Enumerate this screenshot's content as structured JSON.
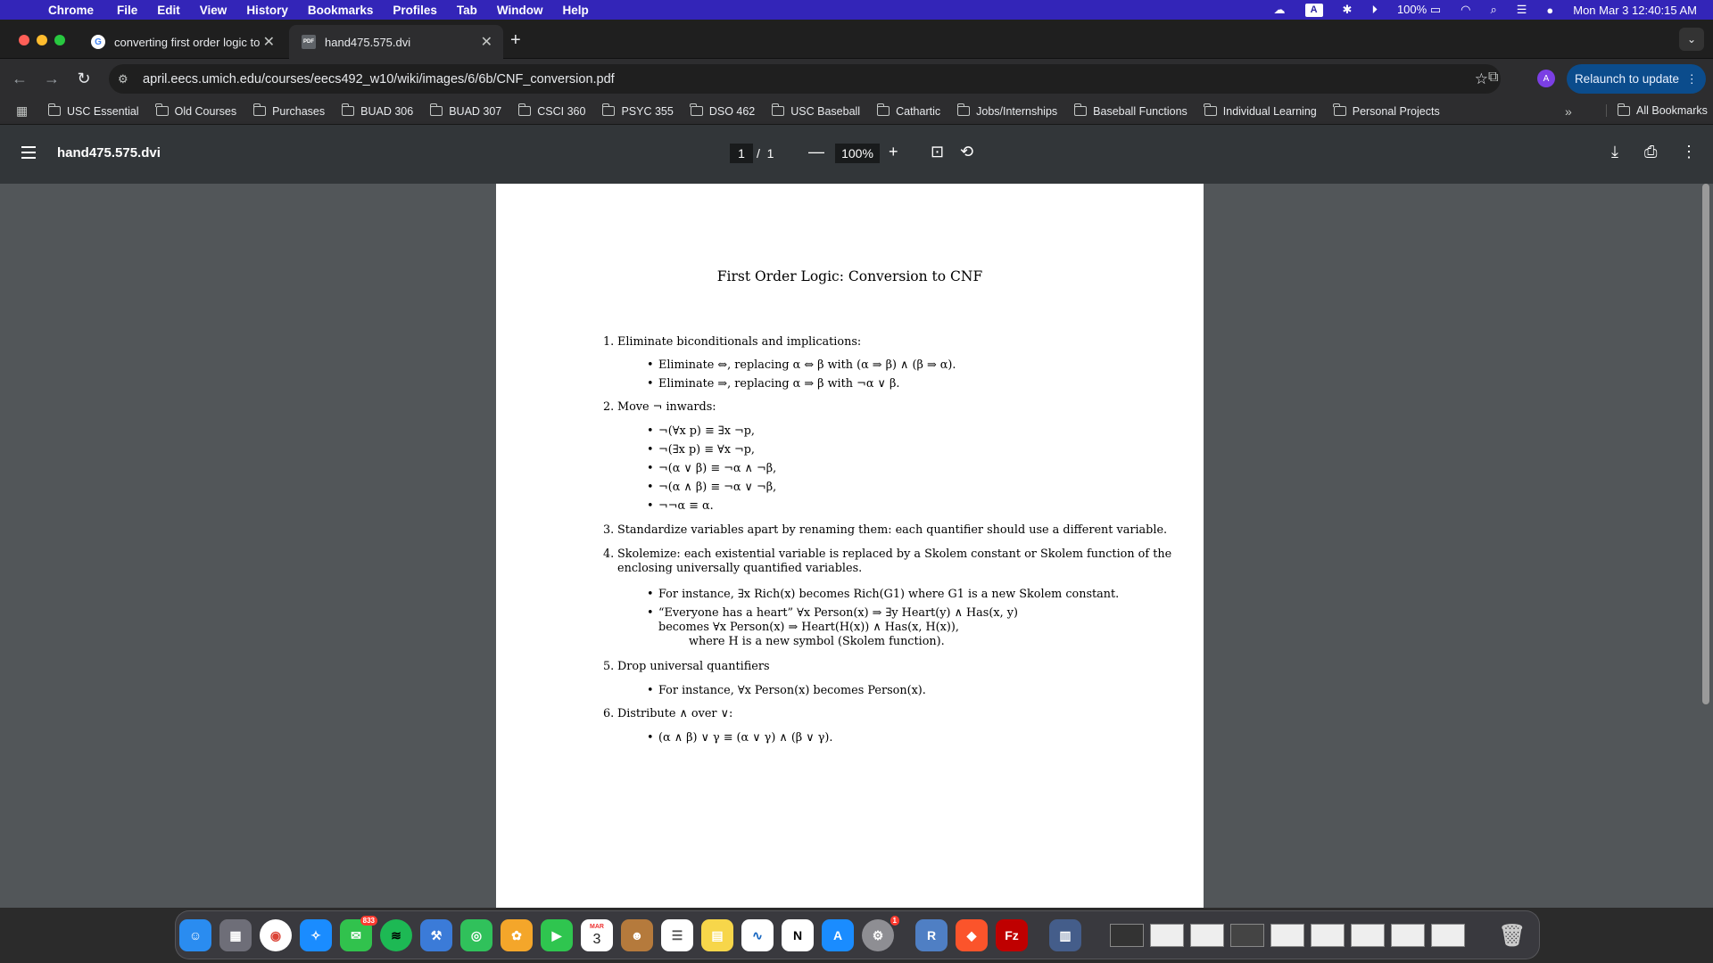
{
  "menubar": {
    "app": "Chrome",
    "items": [
      "File",
      "Edit",
      "View",
      "History",
      "Bookmarks",
      "Profiles",
      "Tab",
      "Window",
      "Help"
    ],
    "battery": "100%",
    "keyboard": "A",
    "datetime": "Mon Mar 3  12:40:15 AM"
  },
  "tabs": [
    {
      "title": "converting first order logic to",
      "icon": "G"
    },
    {
      "title": "hand475.575.dvi",
      "icon": "PDF"
    }
  ],
  "address": {
    "url": "april.eecs.umich.edu/courses/eecs492_w10/wiki/images/6/6b/CNF_conversion.pdf"
  },
  "profile": {
    "initial": "A"
  },
  "relaunch": "Relaunch to update",
  "bookmarks": [
    "USC Essential",
    "Old Courses",
    "Purchases",
    "BUAD 306",
    "BUAD 307",
    "CSCI 360",
    "PSYC 355",
    "DSO 462",
    "USC Baseball",
    "Cathartic",
    "Jobs/Internships",
    "Baseball Functions",
    "Individual Learning",
    "Personal Projects"
  ],
  "all_bookmarks": "All Bookmarks",
  "pdf": {
    "title": "hand475.575.dvi",
    "page": "1",
    "total": "1",
    "zoom": "100%"
  },
  "doc": {
    "title": "First Order Logic: Conversion to CNF",
    "s1": "Eliminate biconditionals and implications:",
    "s1a": "Eliminate ⇔, replacing α ⇔ β with (α ⇒ β) ∧ (β ⇒ α).",
    "s1b": "Eliminate ⇒, replacing α ⇒ β with ¬α ∨ β.",
    "s2": "Move ¬ inwards:",
    "s2a": "¬(∀x  p) ≡ ∃x  ¬p,",
    "s2b": "¬(∃x  p) ≡ ∀x  ¬p,",
    "s2c": "¬(α ∨ β) ≡ ¬α ∧ ¬β,",
    "s2d": "¬(α ∧ β) ≡ ¬α ∨ ¬β,",
    "s2e": "¬¬α ≡ α.",
    "s3": "Standardize variables apart by renaming them: each quantifier should use a different variable.",
    "s4a": "Skolemize: each existential variable is replaced by a Skolem constant or Skolem function of the",
    "s4b": "enclosing universally quantified variables.",
    "s4i": "For instance, ∃x Rich(x) becomes Rich(G1) where G1 is a new Skolem constant.",
    "s4j": "“Everyone has a heart”   ∀x  Person(x) ⇒ ∃y  Heart(y) ∧ Has(x, y)",
    "s4k": "becomes ∀x  Person(x) ⇒ Heart(H(x)) ∧ Has(x, H(x)),",
    "s4l": "where H is a new symbol (Skolem function).",
    "s5": "Drop universal quantifiers",
    "s5a": "For instance,   ∀x  Person(x)   becomes   Person(x).",
    "s6": "Distribute ∧ over ∨:",
    "s6a": "(α ∧ β) ∨ γ ≡ (α ∨ γ) ∧ (β ∨ γ)."
  },
  "dock": {
    "messages_badge": "833",
    "settings_badge": "1",
    "calendar_month": "MAR",
    "calendar_day": "3"
  }
}
